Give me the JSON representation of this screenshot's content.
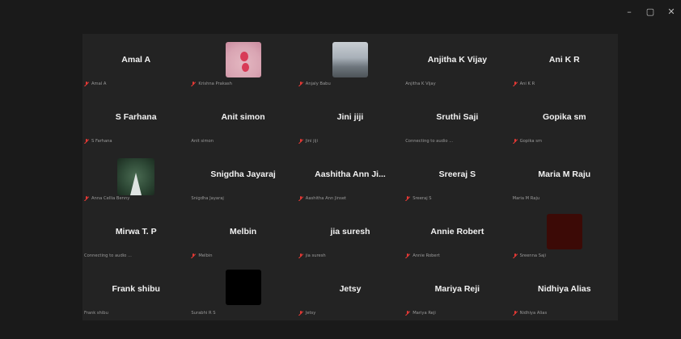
{
  "window_controls": [
    "–",
    "▢",
    "✕"
  ],
  "participants": [
    {
      "name": "Amal A",
      "footer": "Amal A",
      "muted": true,
      "thumb": null
    },
    {
      "name": "",
      "footer": "Krishna Prakash",
      "muted": true,
      "thumb": "flower"
    },
    {
      "name": "",
      "footer": "Anjaly Babu",
      "muted": true,
      "thumb": "landscape"
    },
    {
      "name": "Anjitha K Vijay",
      "footer": "Anjitha K Vijay",
      "muted": false,
      "thumb": null
    },
    {
      "name": "Ani K R",
      "footer": "Ani K R",
      "muted": true,
      "thumb": null
    },
    {
      "name": "S Farhana",
      "footer": "S Farhana",
      "muted": true,
      "thumb": null
    },
    {
      "name": "Anit simon",
      "footer": "Anit simon",
      "muted": false,
      "thumb": null
    },
    {
      "name": "Jini jiji",
      "footer": "Jini jiji",
      "muted": true,
      "thumb": null
    },
    {
      "name": "Sruthi Saji",
      "footer": "Connecting to audio ...",
      "muted": false,
      "thumb": null
    },
    {
      "name": "Gopika sm",
      "footer": "Gopika sm",
      "muted": true,
      "thumb": null
    },
    {
      "name": "",
      "footer": "Anna Cellia Benny",
      "muted": true,
      "thumb": "bridge"
    },
    {
      "name": "Snigdha Jayaraj",
      "footer": "Snigdha Jayaraj",
      "muted": false,
      "thumb": null
    },
    {
      "name": "Aashitha Ann Ji...",
      "footer": "Aashitha Ann Jinset",
      "muted": true,
      "thumb": null
    },
    {
      "name": "Sreeraj S",
      "footer": "Sreeraj S",
      "muted": true,
      "thumb": null
    },
    {
      "name": "Maria M Raju",
      "footer": "Maria M Raju",
      "muted": false,
      "thumb": null
    },
    {
      "name": "Mirwa T. P",
      "footer": "Connecting to audio ...",
      "muted": false,
      "thumb": null
    },
    {
      "name": "Melbin",
      "footer": "Melbin",
      "muted": true,
      "thumb": null
    },
    {
      "name": "jia suresh",
      "footer": "jia suresh",
      "muted": true,
      "thumb": null
    },
    {
      "name": "Annie Robert",
      "footer": "Annie Robert",
      "muted": true,
      "thumb": null
    },
    {
      "name": "",
      "footer": "Sreenna Saji",
      "muted": true,
      "thumb": "darkred"
    },
    {
      "name": "Frank shibu",
      "footer": "Frank shibu",
      "muted": false,
      "thumb": null
    },
    {
      "name": "",
      "footer": "Surabhi R S",
      "muted": false,
      "thumb": "black"
    },
    {
      "name": "Jetsy",
      "footer": "Jetsy",
      "muted": true,
      "thumb": null
    },
    {
      "name": "Mariya Reji",
      "footer": "Mariya Reji",
      "muted": true,
      "thumb": null
    },
    {
      "name": "Nidhiya Alias",
      "footer": "Nidhiya Alias",
      "muted": true,
      "thumb": null
    }
  ]
}
